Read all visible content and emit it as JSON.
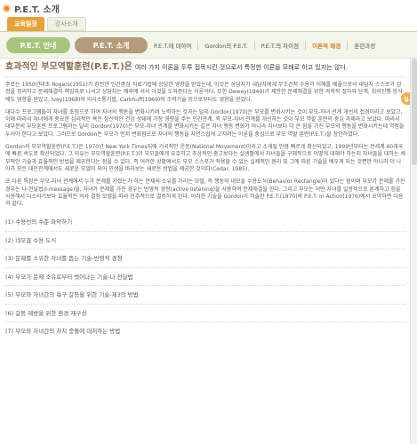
{
  "page": {
    "title": "P.E.T. 소개"
  },
  "top_tabs": [
    {
      "label": "교육일정",
      "active": true
    },
    {
      "label": "강사소개",
      "active": false
    }
  ],
  "subnav": {
    "pill_left": "P.E.T. 안내",
    "pill_right": "P.E.T. 소개",
    "links": [
      "P.E.T.에 대하여",
      "Gordon의 P.E.T.",
      "P.E.T.의 차이점",
      "이론적 배경",
      "훈련과정"
    ],
    "current_link_index": 3
  },
  "side_popup": {
    "label": "실시"
  },
  "content": {
    "headline_emphasis": "효과적인 부모역할훈련(P.E.T.)은",
    "headline_rest": "여러 가지 이론을 두루 접목시킨 것으로서 특정한 이론을 모태로 하고 있지는 않다.",
    "paragraphs": [
      "주로는 1950년대초 Rogers(1951)가 창안한 인간중심 치료기법에 상당한 영향을 받았는데, 이것은 상담자가 내담자에게 무조건적 수용과 이해를 베풀으로서 내담자 스스로가 감정을 정리하고 문제해결의 책임자로 나서고 상담자는 배후에 서서 이것을 도와준다는 이론이다. 또한 Dewey(1949)가 제안한 문제해결을 위한 과학적 절차와 단계, 회의진행 방식에도 영향을 받았고, Ivey(1968)의 의사소통기법, Carkhuff(1969)의 조력기술 등으로부터도 영향을 받았다.",
      "대다수 프로그램들이 자녀를 초점으로 하여 자녀의 행동을 변화시키려 노력하는 것과는 달리 Gordon(1970)은 부모를 변화시키는 것이 부모-자녀 관계 개선의 첩경이라고 보았고, 이에 따라서 자녀에게 중요한 심리적인 욕은 정신적인 건강 상태에 가장 영향을 주는 인간관계, 즉 부모-자녀 관계를 개선하는 것이 부모 역할 훈련의 중심 과제라고 보았다. 따라서 대부분의 부모훈련 프로그램과는 달리 Gordon(1970)은 부모-자녀 관계를 변화시키는 길은 자녀 행동 변화가 아니라 자녀보다 더 큰 힘을 가진 부모의 행동을 변화시키는데 역점을 두어야 한다고 보았다. 그러므로 Gordon은 부모가 먼저 변화함으로 자녀의 행동을 자연스럽게 고치려는 이론을 중심으로 부모 역할 훈련(P.E.T.)을 창안하였다.",
      "Gordon의 부모역할훈련(P.E.T.)은 1970년 New York Times지에 거국적인 운동(National Movement)이라고 소개될 만큼 빠르게 확산되었고, 1999년부터는 전세계 40개국에 빠른 속도로 확산되었다. 그 이유는 부모역할훈련(P.E.T.)이 부모들에게 요호하고 추상적인 충고보다는 실생활에서 자녀들을 구체적으로 어떻게 대해야 하는지 자녀들을 대하는 세부적인 기술과 효율적인 방법을 제공한다는 점을 수 있다. 즉 어려한 상황에서도 부모 스스로가 적용할 수 있는 실제적인 원리 및 그에 따른 기술을 배우게 되는 것뿐만 아니라 더 나아가 모든 대인관계에서도 새로운 모델이 되어 인생을 바라보는 새로운 방법을 제공한 것이다(Cedar, 1985).",
      "또 다른 특징은 부모-자녀 관계에서 누가 문제를 가졌는가 하는 문제의 소유를 가리는 모델, 즉 행동의 네모꼴 수용도식(Behavior Rectangle)이 있다는 점이며 부모가 문제를 가진 경우는 나-전달법(I-message)을, 자녀가 문제를 가진 경우는 반영적 경청(active listening)을 사용하여 문제해결을 한다. 그리고 부모는 어떤 자녀를 일방적으로 훈계하고 힘을 사용해서 다스리기보다 효율적인 의사 결정 모델을 따라 민주적으로 결정하게 된다. 이러한 기술을 Gordon이 저술한 P.E.T.(1970)와 P.E.T. In Action(1976)에서 요약하면 다음과 같다."
    ],
    "steps": [
      "(1) 수용선의 수준 파악하기",
      "(2) 네모꼴 수용 도식",
      "(3) 문제를 소유한 자녀를 돕는 기술-반영적 경청",
      "(4) 부모가 문제 소유로부터 벗어나는 기술-나 전달법",
      "(5) 부모와 자녀간의 욕구 갈등을 위한 기술-제3의 방법",
      "(6) 갈등 예방을 위한 환경 재구성",
      "(7) 부모와 자녀간의 차치 충돌에 대처하는 방법"
    ]
  },
  "colors": {
    "accent_orange": "#e8a23a",
    "pill_green": "#a8c47a",
    "pill_brown": "#b59b7a",
    "current_link": "#e07d1e"
  }
}
